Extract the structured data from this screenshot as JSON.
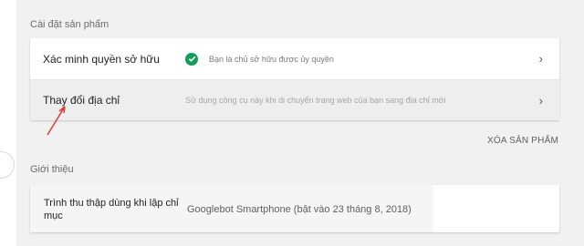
{
  "product_settings": {
    "title": "Cài đặt sản phẩm",
    "rows": [
      {
        "label": "Xác minh quyền sở hữu",
        "description": "Bạn là chủ sở hữu được ủy quyền",
        "status_icon": "check-circle-icon",
        "chevron": "›"
      },
      {
        "label": "Thay đổi địa chỉ",
        "description": "Sử dụng công cụ này khi di chuyển trang web của bạn sang địa chỉ mới",
        "chevron": "›"
      }
    ],
    "delete_button": "XÓA SẢN PHẨM"
  },
  "intro": {
    "title": "Giới thiệu",
    "crawler_label": "Trình thu thập dùng khi lập chỉ mục",
    "crawler_value": "Googlebot Smartphone (bật vào 23 tháng 8, 2018)"
  },
  "colors": {
    "check_green": "#0f9d58",
    "annotation_red": "#e53935",
    "page_background": "#f1f1f1"
  }
}
